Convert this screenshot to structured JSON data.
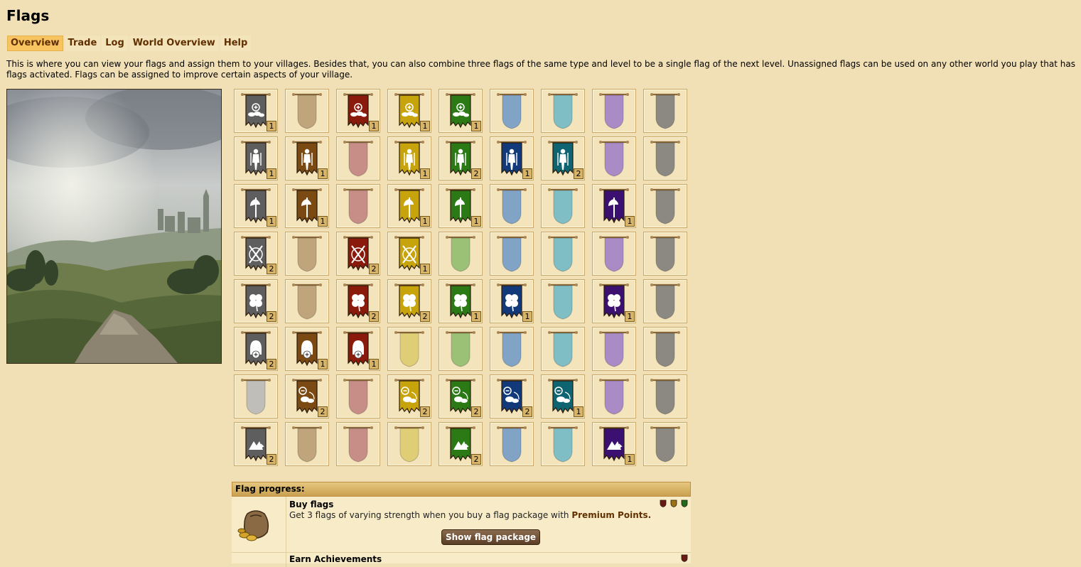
{
  "page": {
    "title": "Flags"
  },
  "tabs": [
    {
      "label": "Overview",
      "active": true
    },
    {
      "label": "Trade",
      "active": false
    },
    {
      "label": "Log",
      "active": false
    },
    {
      "label": "World Overview",
      "active": false
    },
    {
      "label": "Help",
      "active": false
    }
  ],
  "description": "This is where you can view your flags and assign them to your villages. Besides that, you can also combine three flags of the same type and level to be a single flag of the next level. Unassigned flags can be used on any other world you play that has flags activated. Flags can be assigned to improve certain aspects of your village.",
  "colors": {
    "grey": "#5e5e5e",
    "brown": "#7a4a12",
    "red": "#8a1a0c",
    "yellow": "#c8a40c",
    "green": "#2c7a16",
    "blue": "#123a7a",
    "teal": "#0e6470",
    "purple": "#3c1070",
    "dark": "#555555",
    "light": [
      "#b8b8b8",
      "#b89a70",
      "#c08080",
      "#dccb6a",
      "#8cbc6c",
      "#6c98c8",
      "#6cb8c8",
      "#9c7cc8",
      "#7a7a7a"
    ]
  },
  "flag_columns": [
    "grey",
    "brown",
    "red",
    "yellow",
    "green",
    "blue",
    "teal",
    "purple",
    "dark"
  ],
  "flag_rows": [
    {
      "type": "resources",
      "icon": "coins-plus-icon",
      "counts": [
        "1",
        null,
        "1",
        "1",
        "1",
        null,
        null,
        null,
        null
      ]
    },
    {
      "type": "recruitment",
      "icon": "soldier-icon",
      "counts": [
        "1",
        "1",
        null,
        "1",
        "2",
        "1",
        "2",
        null,
        null
      ]
    },
    {
      "type": "attack",
      "icon": "axe-icon",
      "counts": [
        "1",
        "1",
        null,
        "1",
        "1",
        null,
        null,
        "1",
        null
      ]
    },
    {
      "type": "defense",
      "icon": "crossed-swords-icon",
      "counts": [
        "2",
        null,
        "2",
        "1",
        null,
        null,
        null,
        null,
        null
      ]
    },
    {
      "type": "luck",
      "icon": "clover-icon",
      "counts": [
        "2",
        null,
        "2",
        "2",
        "1",
        "1",
        null,
        "1",
        null
      ]
    },
    {
      "type": "population",
      "icon": "helmet-plus-icon",
      "counts": [
        "2",
        "1",
        "1",
        null,
        null,
        null,
        null,
        null,
        null
      ]
    },
    {
      "type": "coin-cost",
      "icon": "coins-minus-icon",
      "counts": [
        null,
        "2",
        null,
        "2",
        "2",
        "2",
        "1",
        null,
        null
      ]
    },
    {
      "type": "haul",
      "icon": "arrow-haul-icon",
      "counts": [
        "2",
        null,
        null,
        null,
        "2",
        null,
        null,
        "1",
        null
      ]
    }
  ],
  "progress": {
    "header": "Flag progress:",
    "buy": {
      "title": "Buy flags",
      "desc_pre": "Get 3 flags of varying strength when you buy a flag package with ",
      "desc_link": "Premium Points.",
      "button": "Show flag package",
      "shield_colors": [
        "#6a1a14",
        "#9a7416",
        "#1f6a1c"
      ]
    },
    "earn": {
      "title": "Earn Achievements",
      "shield_color": "#6a1a14"
    }
  }
}
